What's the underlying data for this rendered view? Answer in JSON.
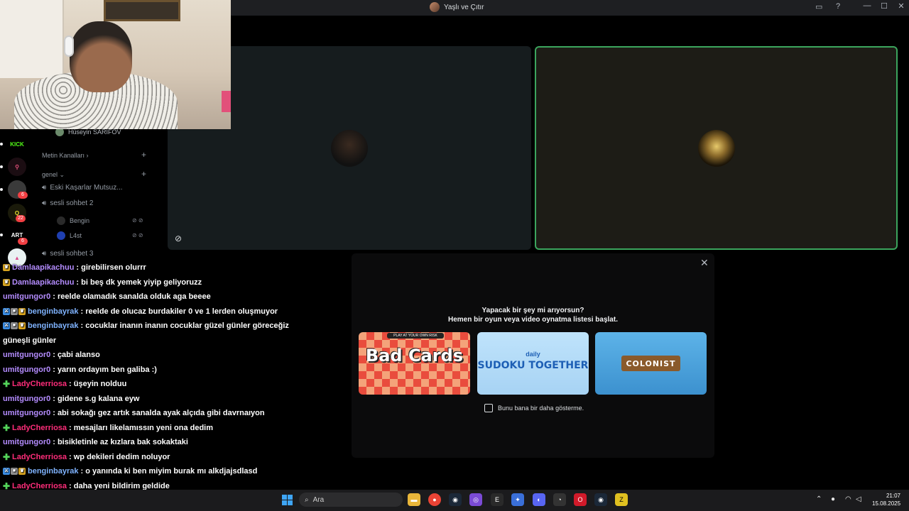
{
  "window": {
    "title": "Yaşlı ve Çıtır"
  },
  "call": {
    "activity": {
      "heading": "Yapacak bir şey mi arıyorsun?",
      "subheading": "Hemen bir oyun veya video oynatma listesi başlat.",
      "cards": [
        {
          "name": "Bad Cards",
          "label": "Bad Cards",
          "top": "PLAY AT YOUR OWN RISK"
        },
        {
          "name": "Daily Sudoku Together",
          "label": "SUDOKU TOGETHER",
          "top": "daily"
        },
        {
          "name": "Colonist",
          "label": "COLONIST"
        }
      ],
      "checkbox_label": "Bunu bana bir daha gösterme."
    }
  },
  "sidebar": {
    "user_top": "Hüseyin SARIFOV",
    "categories": [
      {
        "label": "Metin Kanalları ›"
      },
      {
        "label": "genel ⌄"
      }
    ],
    "voice_channels": [
      {
        "label": "Eski Kaşarlar Mutsuz..."
      },
      {
        "label": "sesli sohbet 2"
      },
      {
        "label": "sesli sohbet 3"
      }
    ],
    "members": [
      {
        "name": "Bengin"
      },
      {
        "name": "L4st"
      }
    ],
    "servers": [
      {
        "label": "KICK",
        "badge": ""
      },
      {
        "label": "",
        "badge": ""
      },
      {
        "label": "",
        "badge": "6"
      },
      {
        "label": "",
        "badge": "22"
      },
      {
        "label": "ART",
        "badge": "6"
      },
      {
        "label": "",
        "badge": ""
      }
    ]
  },
  "chat": [
    {
      "user": "Damlaapikachuu",
      "text": ": girebilirsen olurrr",
      "color": "purple"
    },
    {
      "user": "Damlaapikachuu",
      "text": ": bi beş dk yemek yiyip geliyoruzz",
      "color": "purple"
    },
    {
      "user": "umitgungor0",
      "text": ": reelde olamadık sanalda olduk aga beeee",
      "color": "purple"
    },
    {
      "user": "benginbayrak",
      "text": ": reelde de olucaz burdakiler 0 ve 1 lerden oluşmuyor",
      "color": "teal"
    },
    {
      "user": "benginbayrak",
      "text": ": cocuklar inanın inanın cocuklar güzel günler göreceğiz",
      "color": "teal"
    },
    {
      "user": "",
      "text": "güneşli günler",
      "color": "none"
    },
    {
      "user": "umitgungor0",
      "text": ": çabi alanso",
      "color": "purple"
    },
    {
      "user": "umitgungor0",
      "text": ": yarın ordayım ben galiba :)",
      "color": "purple"
    },
    {
      "user": "LadyCherriosa",
      "text": ": üşeyin nolduu",
      "color": "pink"
    },
    {
      "user": "umitgungor0",
      "text": ": gidene s.g kalana eyw",
      "color": "purple"
    },
    {
      "user": "umitgungor0",
      "text": ": abi sokağı gez artık sanalda ayak alçıda gibi davrnaıyon",
      "color": "purple"
    },
    {
      "user": "LadyCherriosa",
      "text": ": mesajları likelamıssın yeni ona dedim",
      "color": "pink"
    },
    {
      "user": "umitgungor0",
      "text": ": bisikletinle az kızlara bak sokaktaki",
      "color": "purple"
    },
    {
      "user": "LadyCherriosa",
      "text": ": wp dekileri dedim noluyor",
      "color": "pink"
    },
    {
      "user": "benginbayrak",
      "text": ": o yanında ki ben miyim burak mı alkdjajsdlasd",
      "color": "teal"
    },
    {
      "user": "LadyCherriosa",
      "text": ": daha yeni bildirim geldide",
      "color": "pink"
    }
  ],
  "taskbar": {
    "search_placeholder": "Ara",
    "time": "21:07",
    "date": "15.08.2025",
    "apps": [
      "explorer",
      "chrome",
      "steam",
      "app",
      "epic",
      "app2",
      "discord",
      "app3",
      "opera",
      "steam2",
      "app4"
    ]
  },
  "colors": {
    "speaking_border": "#3ba55d",
    "chat_pink": "#ff2d7a",
    "chat_purple": "#b48cff"
  }
}
